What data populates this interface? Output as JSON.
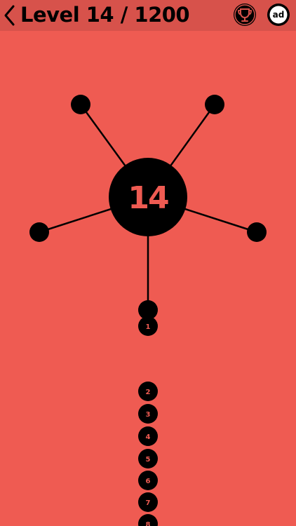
{
  "header": {
    "title": "Level 14 / 1200",
    "back_icon": "chevron-left-icon",
    "trophy_icon": "trophy-icon",
    "ad_label": "ad"
  },
  "game": {
    "center_label": "14",
    "queue_numbers": [
      "1",
      "2",
      "3",
      "4",
      "5",
      "6",
      "7",
      "8"
    ],
    "colors": {
      "background": "#ef5b52",
      "topbar": "#d7524b",
      "pieces": "#000000"
    }
  }
}
